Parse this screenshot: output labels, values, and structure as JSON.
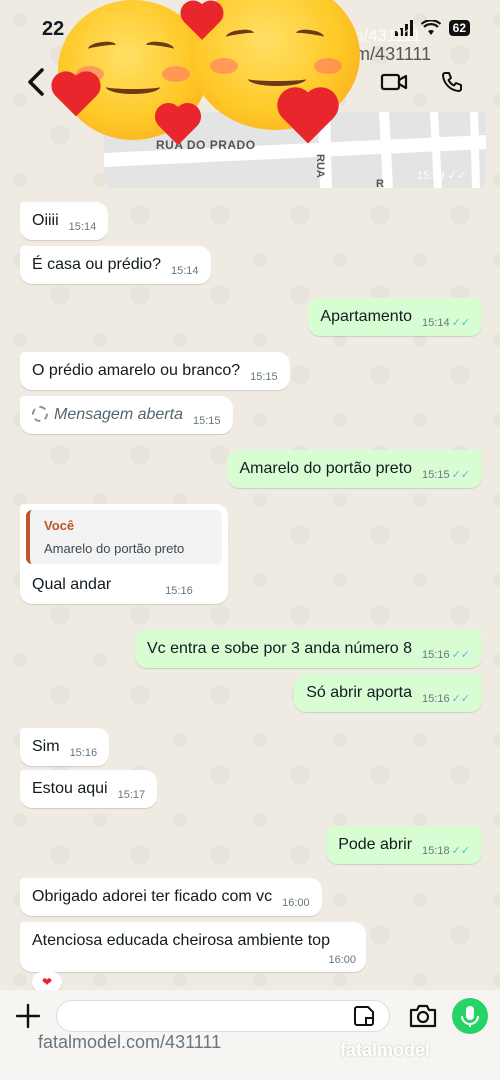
{
  "status": {
    "time": "22",
    "battery": "62"
  },
  "map": {
    "street_name": "RUA DO PRADO",
    "street_side": "RUA",
    "street_edge": "R",
    "time": "15:09",
    "ticks": "✓✓"
  },
  "watermark": {
    "top_overlay": "fatalmodel.com/431111",
    "top": "fatalmodel.com/431111",
    "bottom": "fatalmodel.com/431111",
    "logo": "fatalmodel"
  },
  "messages": [
    {
      "text": "Oiiii",
      "time": "15:14"
    },
    {
      "text": "É casa ou prédio?",
      "time": "15:14"
    },
    {
      "text": "Apartamento",
      "time": "15:14",
      "ticks": "✓✓"
    },
    {
      "text": "O prédio amarelo ou branco?",
      "time": "15:15"
    },
    {
      "text": "Mensagem aberta",
      "time": "15:15"
    },
    {
      "text": "Amarelo do portão preto",
      "time": "15:15",
      "ticks": "✓✓"
    },
    {
      "quote_author": "Você",
      "quote_text": "Amarelo do portão preto",
      "text": "Qual andar",
      "time": "15:16"
    },
    {
      "text": "Vc entra e sobe por 3 anda número 8",
      "time": "15:16",
      "ticks": "✓✓"
    },
    {
      "text": "Só abrir aporta",
      "time": "15:16",
      "ticks": "✓✓"
    },
    {
      "text": "Sim",
      "time": "15:16"
    },
    {
      "text": "Estou aqui",
      "time": "15:17"
    },
    {
      "text": "Pode abrir",
      "time": "15:18",
      "ticks": "✓✓"
    },
    {
      "text": "Obrigado adorei ter ficado com vc",
      "time": "16:00"
    },
    {
      "text": "Atenciosa educada cheirosa ambiente top",
      "time": "16:00"
    }
  ],
  "reaction": "❤",
  "composer": {
    "placeholder": ""
  },
  "icons": {
    "back": "chevron-left-icon",
    "video": "video-call-icon",
    "phone": "phone-icon",
    "plus": "plus-icon",
    "sticker": "sticker-icon",
    "camera": "camera-icon",
    "mic": "microphone-icon"
  },
  "colors": {
    "wallpaper": "#efeae2",
    "incoming": "#ffffff",
    "outgoing": "#d9fdd3",
    "read_ticks": "#53bdeb",
    "quote_accent": "#c0542b",
    "mic": "#25d366"
  }
}
